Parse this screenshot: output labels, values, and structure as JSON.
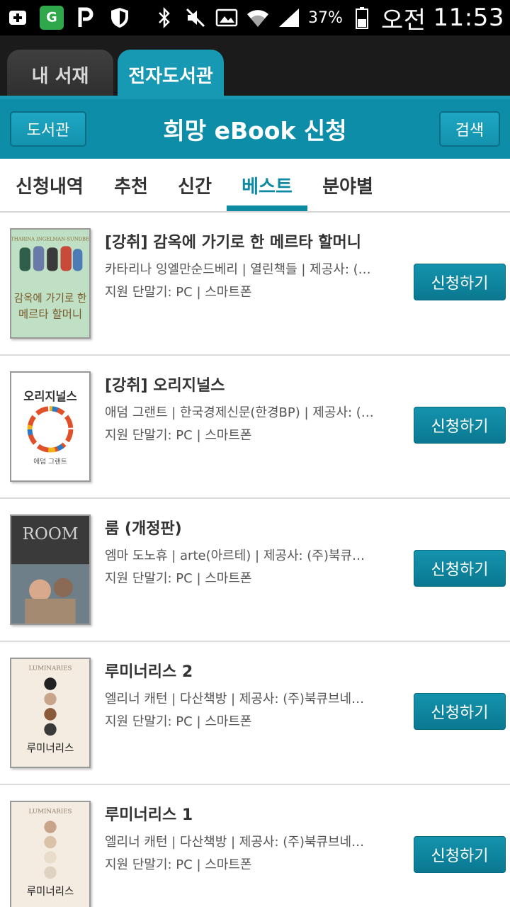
{
  "status_bar": {
    "battery_percent": "37%",
    "ampm": "오전",
    "time": "11:53",
    "icons": [
      "plus-square-icon",
      "gmarket-icon",
      "parking-icon",
      "shield-icon",
      "bluetooth-icon",
      "mute-icon",
      "photo-icon",
      "wifi-icon",
      "signal-icon",
      "battery-icon"
    ]
  },
  "top_tabs": {
    "my_library": "내 서재",
    "ebook_library": "전자도서관"
  },
  "header": {
    "library_button": "도서관",
    "title": "희망 eBook 신청",
    "search_button": "검색"
  },
  "sub_tabs": [
    "신청내역",
    "추천",
    "신간",
    "베스트",
    "분야별"
  ],
  "books": [
    {
      "title": "[강취] 감옥에 가기로 한 메르타 할머니",
      "meta": "카타리나 잉엘만순드베리 | 열린책들 | 제공사: (주)...",
      "device": "지원 단말기: PC | 스마트폰",
      "button": "신청하기",
      "cover_text": "감옥에 가기로 한 메르타 할머니",
      "cover_author": "CATHARINA INGELMAN-SUNDBERG"
    },
    {
      "title": "[강취] 오리지널스",
      "meta": "애덤 그랜트 | 한국경제신문(한경BP) | 제공사: (주)...",
      "device": "지원 단말기: PC | 스마트폰",
      "button": "신청하기",
      "cover_text": "오리지널스",
      "cover_author": "애덤 그랜트"
    },
    {
      "title": "룸 (개정판)",
      "meta": "엠마 도노휴 | arte(아르테) | 제공사: (주)북큐브네...",
      "device": "지원 단말기: PC | 스마트폰",
      "button": "신청하기",
      "cover_text": "ROOM"
    },
    {
      "title": "루미너리스 2",
      "meta": "엘리너 캐턴 | 다산책방 | 제공사: (주)북큐브네트웍...",
      "device": "지원 단말기: PC | 스마트폰",
      "button": "신청하기",
      "cover_text": "루미너리스",
      "cover_author": "LUMINARIES"
    },
    {
      "title": "루미너리스 1",
      "meta": "엘리너 캐턴 | 다산책방 | 제공사: (주)북큐브네트웍...",
      "device": "지원 단말기: PC | 스마트폰",
      "button": "신청하기",
      "cover_text": "루미너리스",
      "cover_author": "LUMINARIES"
    }
  ],
  "colors": {
    "accent": "#0e8da8",
    "tab_active": "#1899b3",
    "button": "#0a7890"
  }
}
